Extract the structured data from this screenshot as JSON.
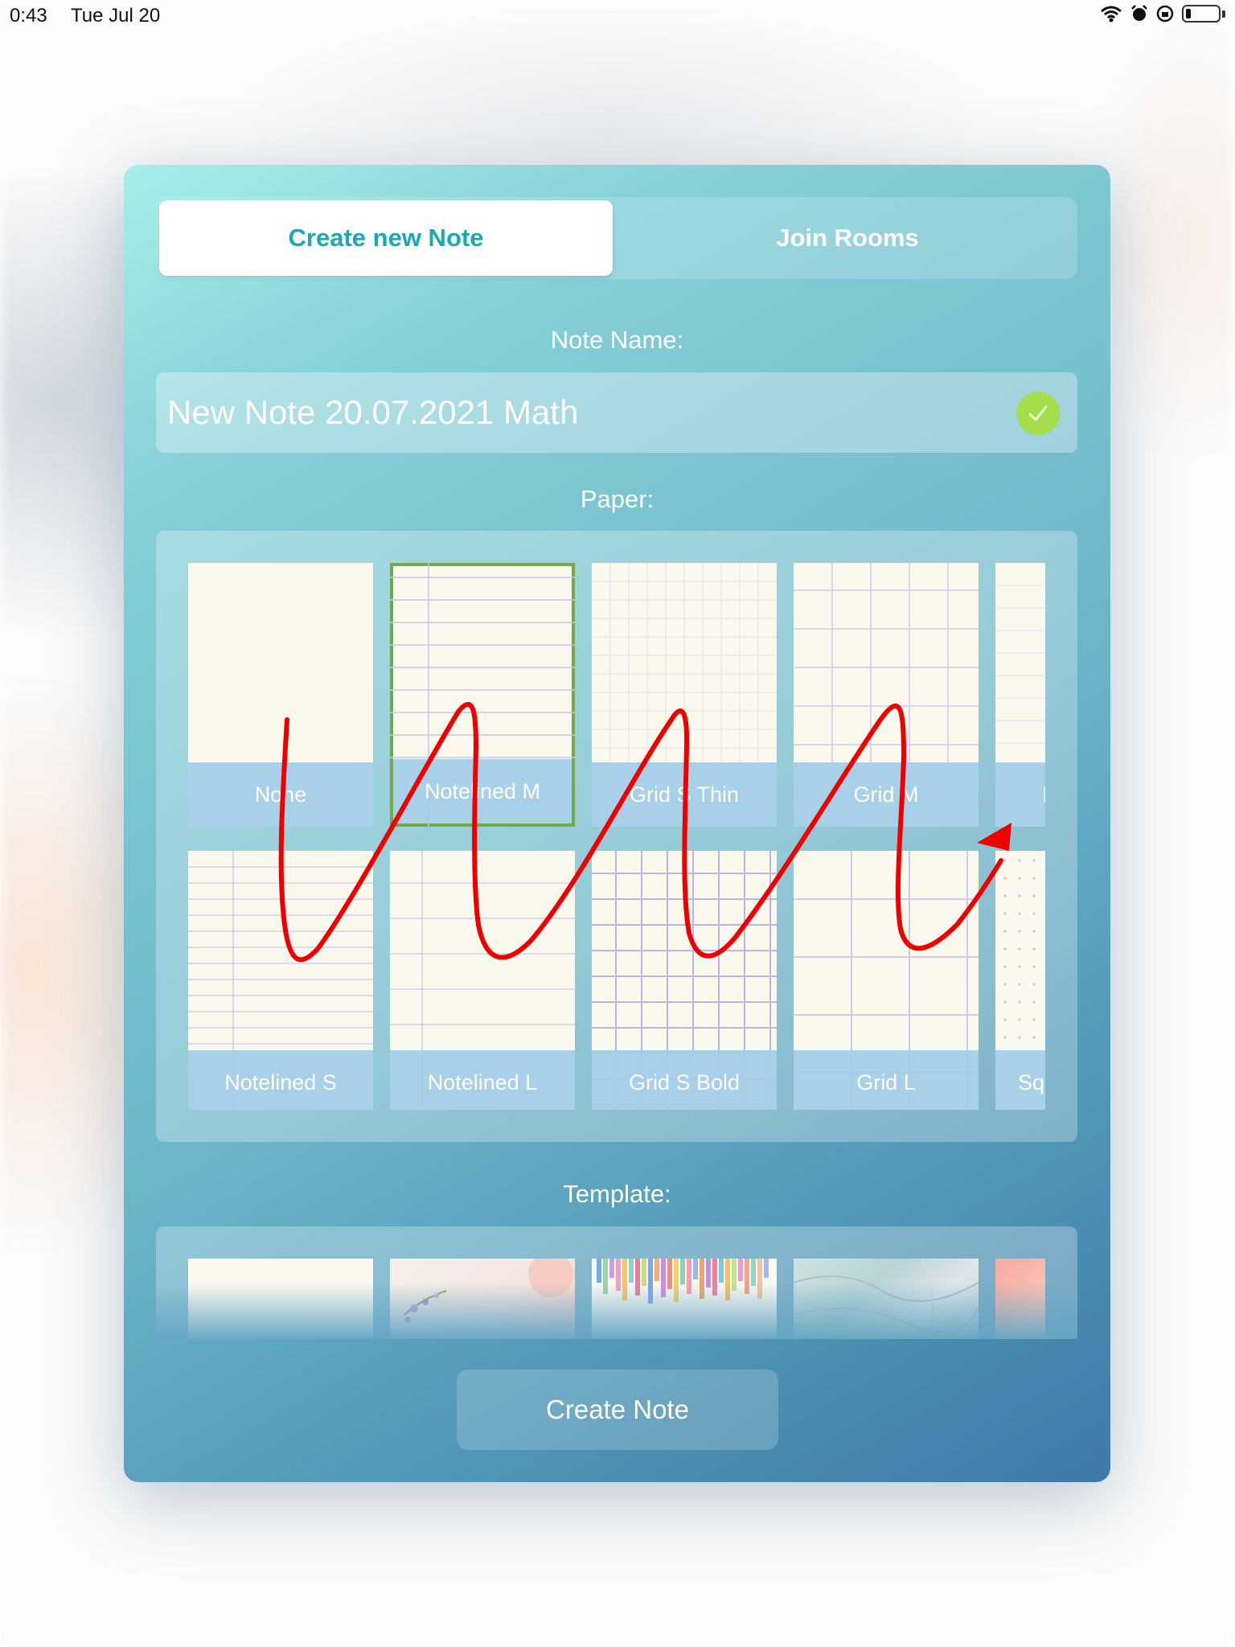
{
  "status_bar": {
    "time": "0:43",
    "date": "Tue Jul 20"
  },
  "tabs": {
    "create_label": "Create new Note",
    "join_label": "Join Rooms"
  },
  "note_name": {
    "label": "Note Name:",
    "value": "New Note 20.07.2021 Math"
  },
  "paper": {
    "label": "Paper:",
    "tiles": [
      {
        "label": "None",
        "selected": false
      },
      {
        "label": "Notelined M",
        "selected": true
      },
      {
        "label": "Grid S Thin",
        "selected": false
      },
      {
        "label": "Grid M",
        "selected": false
      },
      {
        "label": "I",
        "selected": false
      },
      {
        "label": "Notelined S",
        "selected": false
      },
      {
        "label": "Notelined L",
        "selected": false
      },
      {
        "label": "Grid S Bold",
        "selected": false
      },
      {
        "label": "Grid L",
        "selected": false
      },
      {
        "label": "Sq",
        "selected": false
      }
    ]
  },
  "template": {
    "label": "Template:"
  },
  "create_button": "Create Note",
  "colors": {
    "accent": "#1ba8b5",
    "selected_outline": "#74a84a",
    "check": "#a6dd4a",
    "annotation": "#ee0000",
    "tile_label_bg": "#a4cde8"
  }
}
